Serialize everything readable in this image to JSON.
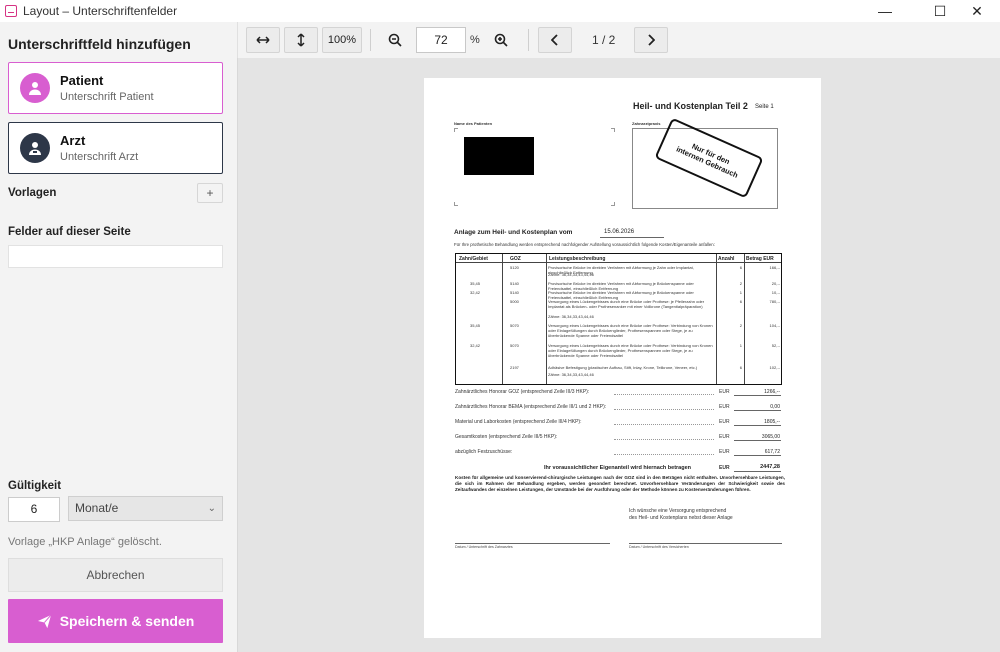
{
  "window": {
    "title": "Layout – Unterschriftenfelder",
    "controls": [
      "—",
      "☐",
      "✕"
    ]
  },
  "sidebar": {
    "heading": "Unterschriftfeld hinzufügen",
    "cards": [
      {
        "name": "Patient",
        "sub": "Unterschrift Patient"
      },
      {
        "name": "Arzt",
        "sub": "Unterschrift Arzt"
      }
    ],
    "templates_label": "Vorlagen",
    "templates_add": "+",
    "fields_label": "Felder auf dieser Seite",
    "validity_label": "Gültigkeit",
    "validity_value": "6",
    "validity_unit": "Monat/e",
    "deleted_msg": "Vorlage „HKP Anlage“ gelöscht.",
    "cancel_label": "Abbrechen",
    "save_label": "Speichern & senden"
  },
  "toolbar": {
    "zoom_100": "100%",
    "zoom_value": "72",
    "zoom_unit": "%",
    "page": "1 / 2"
  },
  "document": {
    "title": "Heil- und Kostenplan Teil 2",
    "seite": "Seite 1",
    "name_label": "Name des Patienten",
    "praxis_label": "Zahnarztpraxis",
    "stamp_lines": [
      "Nur für den",
      "internen Gebrauch"
    ],
    "anlage_label": "Anlage zum Heil- und Kostenplan vom",
    "anlage_date": "15.06.2026",
    "intro": "Für Ihre prothetische Behandlung werden entsprechend nachfolgender Aufstellung voraussichtlich folgende Kosten/Eigenanteile anfallen:",
    "table_headers": [
      "Zahn/Gebiet",
      "GOZ",
      "Leistungsbeschreibung",
      "Anzahl",
      "Betrag EUR"
    ],
    "table_rows": [
      {
        "zahn": "",
        "goz": "5120",
        "desc": "Provisorische Brücke im direkten Verfahren mit Abformung je Zahn oder Implantat, einschließlich Entfernung",
        "anzahl": "6",
        "betrag": "166,--"
      },
      {
        "zahn": "",
        "goz": "",
        "desc": "Zähne: 36,34,33,43,44,46",
        "anzahl": "",
        "betrag": ""
      },
      {
        "zahn": "35,45",
        "goz": "5140",
        "desc": "Provisorische Brücke im direkten Verfahren mit Abformung je Brückenspanne oder Freiendsattel, einschließlich Entfernung",
        "anzahl": "2",
        "betrag": "20,--"
      },
      {
        "zahn": "32,42",
        "goz": "5140",
        "desc": "Provisorische Brücke im direkten Verfahren mit Abformung je Brückenspanne oder Freiendsattel, einschließlich Entfernung",
        "anzahl": "1",
        "betrag": "10,--"
      },
      {
        "zahn": "",
        "goz": "5000",
        "desc": "Versorgung eines Lückengebisses durch eine Brücke oder Prothese: je Pfeilerzahn oder Implantat als Brücken- oder Prothesenanker mit einer Vollkrone (Tangentialpräparation)",
        "anzahl": "6",
        "betrag": "780,--"
      },
      {
        "zahn": "",
        "goz": "",
        "desc": "Zähne: 36,34,33,43,44,46",
        "anzahl": "",
        "betrag": ""
      },
      {
        "zahn": "35,45",
        "goz": "5070",
        "desc": "Versorgung eines Lückengebisses durch eine Brücke oder Prothese: Verbindung von Kronen oder Einlagefüllungen durch Brückenglieder, Prothesenspannen oder Stege, je zu überbrückende Spanne oder Freiendsattel",
        "anzahl": "2",
        "betrag": "104,--"
      },
      {
        "zahn": "32,42",
        "goz": "5070",
        "desc": "Versorgung eines Lückengebisses durch eine Brücke oder Prothese: Verbindung von Kronen oder Einlagefüllungen durch Brückenglieder, Prothesenspannen oder Stege, je zu überbrückende Spanne oder Freiendsattel",
        "anzahl": "1",
        "betrag": "52,--"
      },
      {
        "zahn": "",
        "goz": "2197",
        "desc": "Adhäsive Befestigung (plastischer Aufbau, Stift, Inlay, Krone, Teilkrone, Veneer, etc.)",
        "anzahl": "6",
        "betrag": "102,--"
      },
      {
        "zahn": "",
        "goz": "",
        "desc": "Zähne: 36,34,33,43,44,46",
        "anzahl": "",
        "betrag": ""
      }
    ],
    "sums": [
      {
        "label": "Zahnärztliches Honorar GOZ (entsprechend Zeile III/3 HKP):",
        "eur": "EUR",
        "value": "1266,--"
      },
      {
        "label": "Zahnärztliches Honorar BEMA (entsprechend Zeile III/1 und 2 HKP):",
        "eur": "EUR",
        "value": "0,00"
      },
      {
        "label": "Material und Laborkosten (entsprechend Zeile III/4 HKP):",
        "eur": "EUR",
        "value": "1805,--"
      },
      {
        "label": "Gesamtkosten (entsprechend Zeile III/5 HKP):",
        "eur": "EUR",
        "value": "3065,00"
      },
      {
        "label": "abzüglich Festzuschüsse:",
        "eur": "EUR",
        "value": "617,72"
      }
    ],
    "eigenanteil_label": "Ihr voraussichtlicher Eigenanteil wird hiernach betragen",
    "eigenanteil_eur": "EUR",
    "eigenanteil_value": "2447,28",
    "disclaimer": "Kosten für allgemeine und konservierend-chirurgische Leistungen nach der GOZ sind in den Beträgen nicht enthalten. Unvorhersehbare Leistungen, die sich im Rahmen der Behandlung ergeben, werden gesondert berechnet. Unvorhersehbare Veränderungen der Schwierigkeit sowie des Zeitaufwandes der einzelnen Leistungen, der Umstände bei der Ausführung oder der Methode können zu Kostenveränderungen führen.",
    "wish_line1": "Ich wünsche eine Versorgung entsprechend",
    "wish_line2": "des Heil- und Kostenplans nebst dieser Anlage",
    "sig_left": "Datum / Unterschrift des Zahnarztes",
    "sig_right": "Datum / Unterschrift des Versicherten"
  },
  "colors": {
    "accent": "#d85ed0",
    "dark": "#2d3748"
  }
}
